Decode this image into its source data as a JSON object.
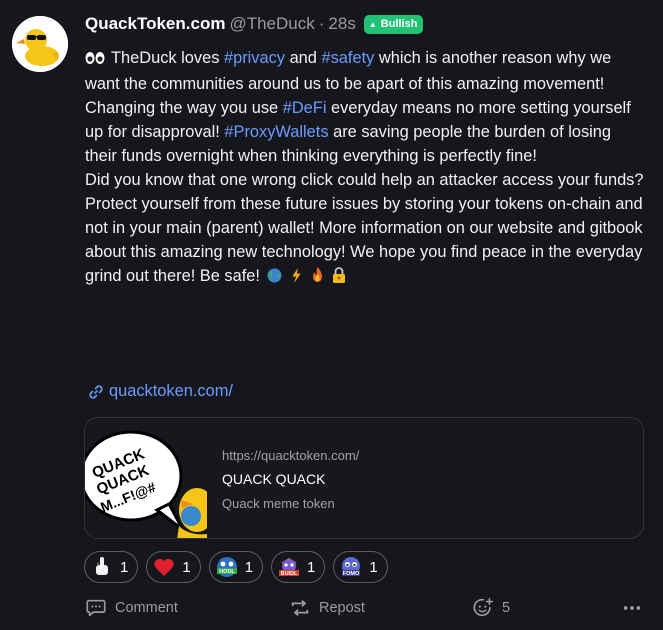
{
  "post": {
    "author_name": "QuackToken.com",
    "handle": "@TheDuck",
    "separator": "·",
    "time": "28s",
    "sentiment_badge": "Bullish",
    "paragraph1": {
      "t1": "TheDuck loves ",
      "tag1": "#privacy",
      "t2": " and ",
      "tag2": "#safety",
      "t3": " which is another reason why we want the communities around us to be apart of this amazing movement! Changing the way you use ",
      "tag3": "#DeFi",
      "t4": " everyday means no more setting yourself up for disapproval! ",
      "tag4": "#ProxyWallets",
      "t5": " are saving people the burden of losing their funds overnight when thinking everything is perfectly fine!"
    },
    "paragraph2": "Did you know that one wrong click could help an attacker access your funds?",
    "paragraph3": "Protect yourself from these future issues by storing your tokens on-chain and not in your main (parent) wallet! More information on our website and gitbook about this amazing new technology! We hope you find peace in the everyday grind out there! Be safe!",
    "link_text": "quacktoken.com/"
  },
  "link_card": {
    "url": "https://quacktoken.com/",
    "title": "QUACK QUACK",
    "description": "Quack meme token",
    "image_text_line1": "QUACK",
    "image_text_line2": "QUACK",
    "image_text_line3": "M...F!@#"
  },
  "reactions": [
    {
      "icon": "finger-up-icon",
      "count": "1"
    },
    {
      "icon": "heart-icon",
      "count": "1"
    },
    {
      "icon": "hodl-icon",
      "count": "1"
    },
    {
      "icon": "buidl-icon",
      "count": "1"
    },
    {
      "icon": "fomo-icon",
      "count": "1"
    }
  ],
  "actions": {
    "comment_label": "Comment",
    "repost_label": "Repost",
    "react_count": "5"
  },
  "colors": {
    "background": "#16171c",
    "link": "#6c9bff",
    "bullish_badge": "#21c273",
    "muted": "#9a9ca4"
  }
}
